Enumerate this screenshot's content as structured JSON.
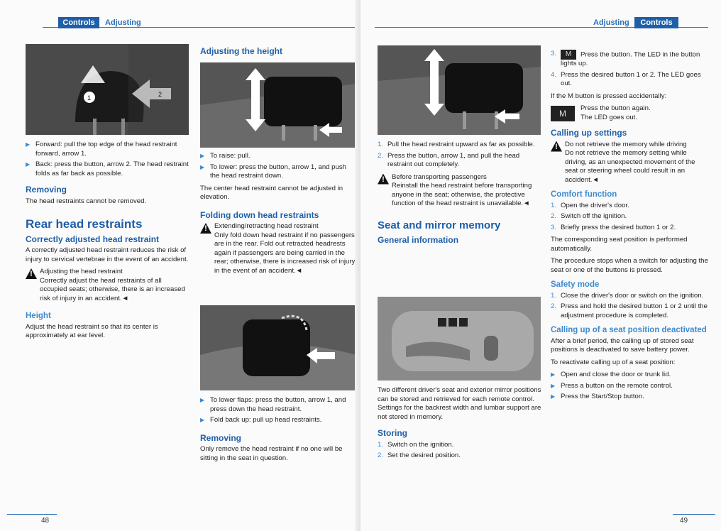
{
  "left_page": {
    "tab_controls": "Controls",
    "tab_adjusting": "Adjusting",
    "page_number": "48",
    "col1": {
      "figure_label": "Front head restraint figure",
      "bullets": [
        "Forward: pull the top edge of the head restraint forward, arrow 1.",
        "Back: press the button, arrow 2. The head restraint folds as far back as possible."
      ],
      "removing_title": "Removing",
      "removing_text": "The head restraints cannot be removed.",
      "rear_title": "Rear head restraints",
      "correct_title": "Correctly adjusted head restraint",
      "correct_text": "A correctly adjusted head restraint reduces the risk of injury to cervical vertebrae in the event of an accident.",
      "warn_first": "Adjusting the head restraint",
      "warn_rest": "Correctly adjust the head restraints of all occupied seats; otherwise, there is an increased risk of injury in an accident.◄",
      "height_title": "Height",
      "height_text": "Adjust the head restraint so that its center is approximately at ear level."
    },
    "col2": {
      "adj_title": "Adjusting the height",
      "bullets": [
        "To raise: pull.",
        "To lower: press the button, arrow 1, and push the head restraint down."
      ],
      "center_text": "The center head restraint cannot be adjusted in elevation.",
      "fold_title": "Folding down head restraints",
      "warn_first": "Extending/retracting head restraint",
      "warn_rest": "Only fold down head restraint if no passengers are in the rear. Fold out retracted headrests again if passengers are being carried in the rear; otherwise, there is increased risk of injury in the event of an accident.◄",
      "bullets2": [
        "To lower flaps: press the button, arrow 1, and press down the head restraint.",
        "Fold back up: pull up head restraints."
      ],
      "removing_title": "Removing",
      "removing_text": "Only remove the head restraint if no one will be sitting in the seat in question."
    }
  },
  "right_page": {
    "tab_adjusting": "Adjusting",
    "tab_controls": "Controls",
    "page_number": "49",
    "col1": {
      "steps": [
        "Pull the head restraint upward as far as possible.",
        "Press the button, arrow 1, and pull the head restraint out completely."
      ],
      "warn_first": "Before transporting passengers",
      "warn_rest": "Reinstall the head restraint before transporting anyone in the seat; otherwise, the protective function of the head restraint is unavailable.◄",
      "memory_title": "Seat and mirror memory",
      "general_title": "General information",
      "general_text": "Two different driver's seat and exterior mirror positions can be stored and retrieved for each remote control. Settings for the backrest width and lumbar support are not stored in memory.",
      "storing_title": "Storing",
      "storing_steps": [
        "Switch on the ignition.",
        "Set the desired position."
      ]
    },
    "col2": {
      "m_label": "M",
      "step3": "Press the button. The LED in the button lights up.",
      "step4": "Press the desired button 1 or 2. The LED goes out.",
      "accidental": "If the M button is pressed accidentally:",
      "again": "Press the button again.",
      "led_out": "The LED goes out.",
      "calling_title": "Calling up settings",
      "warn_first": "Do not retrieve the memory while driving",
      "warn_rest": "Do not retrieve the memory setting while driving, as an unexpected movement of the seat or steering wheel could result in an accident.◄",
      "comfort_title": "Comfort function",
      "comfort_steps": [
        "Open the driver's door.",
        "Switch off the ignition.",
        "Briefly press the desired button 1 or 2."
      ],
      "comfort_text1": "The corresponding seat position is performed automatically.",
      "comfort_text2": "The procedure stops when a switch for adjusting the seat or one of the buttons is pressed.",
      "safety_title": "Safety mode",
      "safety_steps": [
        "Close the driver's door or switch on the ignition.",
        "Press and hold the desired button 1 or 2 until the adjustment procedure is completed."
      ],
      "deact_title": "Calling up of a seat position deactivated",
      "deact_text": "After a brief period, the calling up of stored seat positions is deactivated to save battery power.",
      "reactivate": "To reactivate calling up of a seat position:",
      "react_bullets": [
        "Open and close the door or trunk lid.",
        "Press a button on the remote control.",
        "Press the Start/Stop button."
      ]
    }
  }
}
